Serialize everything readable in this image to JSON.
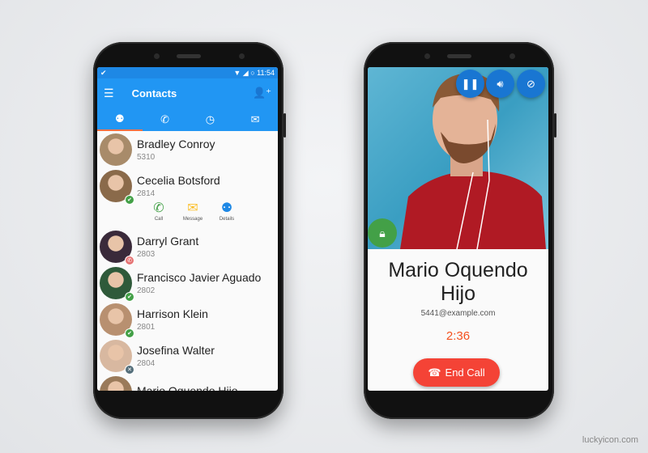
{
  "contacts_screen": {
    "status_time": "11:54",
    "title": "Contacts",
    "tabs": [
      {
        "name": "contacts",
        "icon": "person-icon"
      },
      {
        "name": "call-transfer",
        "icon": "phone-forward-icon"
      },
      {
        "name": "history",
        "icon": "clock-icon"
      },
      {
        "name": "messages",
        "icon": "mail-icon"
      }
    ],
    "active_tab": 0,
    "contacts": [
      {
        "name": "Bradley Conroy",
        "number": "5310",
        "status": "none",
        "avatar_color": "#a88b6a"
      },
      {
        "name": "Cecelia Botsford",
        "number": "2814",
        "status": "available",
        "avatar_color": "#8a6a4a"
      },
      {
        "name": "Darryl Grant",
        "number": "2803",
        "status": "on-call",
        "avatar_color": "#3a2a3a"
      },
      {
        "name": "Francisco Javier Aguado",
        "number": "2802",
        "status": "available",
        "avatar_color": "#2f5a3a"
      },
      {
        "name": "Harrison Klein",
        "number": "2801",
        "status": "available",
        "avatar_color": "#b89070"
      },
      {
        "name": "Josefina Walter",
        "number": "2804",
        "status": "offline",
        "avatar_color": "#d8b8a0"
      },
      {
        "name": "Mario Oquendo Hijo",
        "number": "",
        "status": "none",
        "avatar_color": "#9a7a5a"
      }
    ],
    "actions": [
      {
        "label": "Call",
        "icon": "phone-icon",
        "color": "#43a047"
      },
      {
        "label": "Message",
        "icon": "mail-icon",
        "color": "#fbc02d"
      },
      {
        "label": "Details",
        "icon": "person-icon",
        "color": "#1e88e5"
      }
    ]
  },
  "call_screen": {
    "name_line1": "Mario Oquendo",
    "name_line2": "Hijo",
    "email": "5441@example.com",
    "duration": "2:36",
    "end_call_label": "End Call"
  },
  "colors": {
    "primary": "#2196f3",
    "accent": "#ff7043",
    "available": "#43a047",
    "end_call": "#f44336"
  },
  "watermark": "luckyicon.com"
}
